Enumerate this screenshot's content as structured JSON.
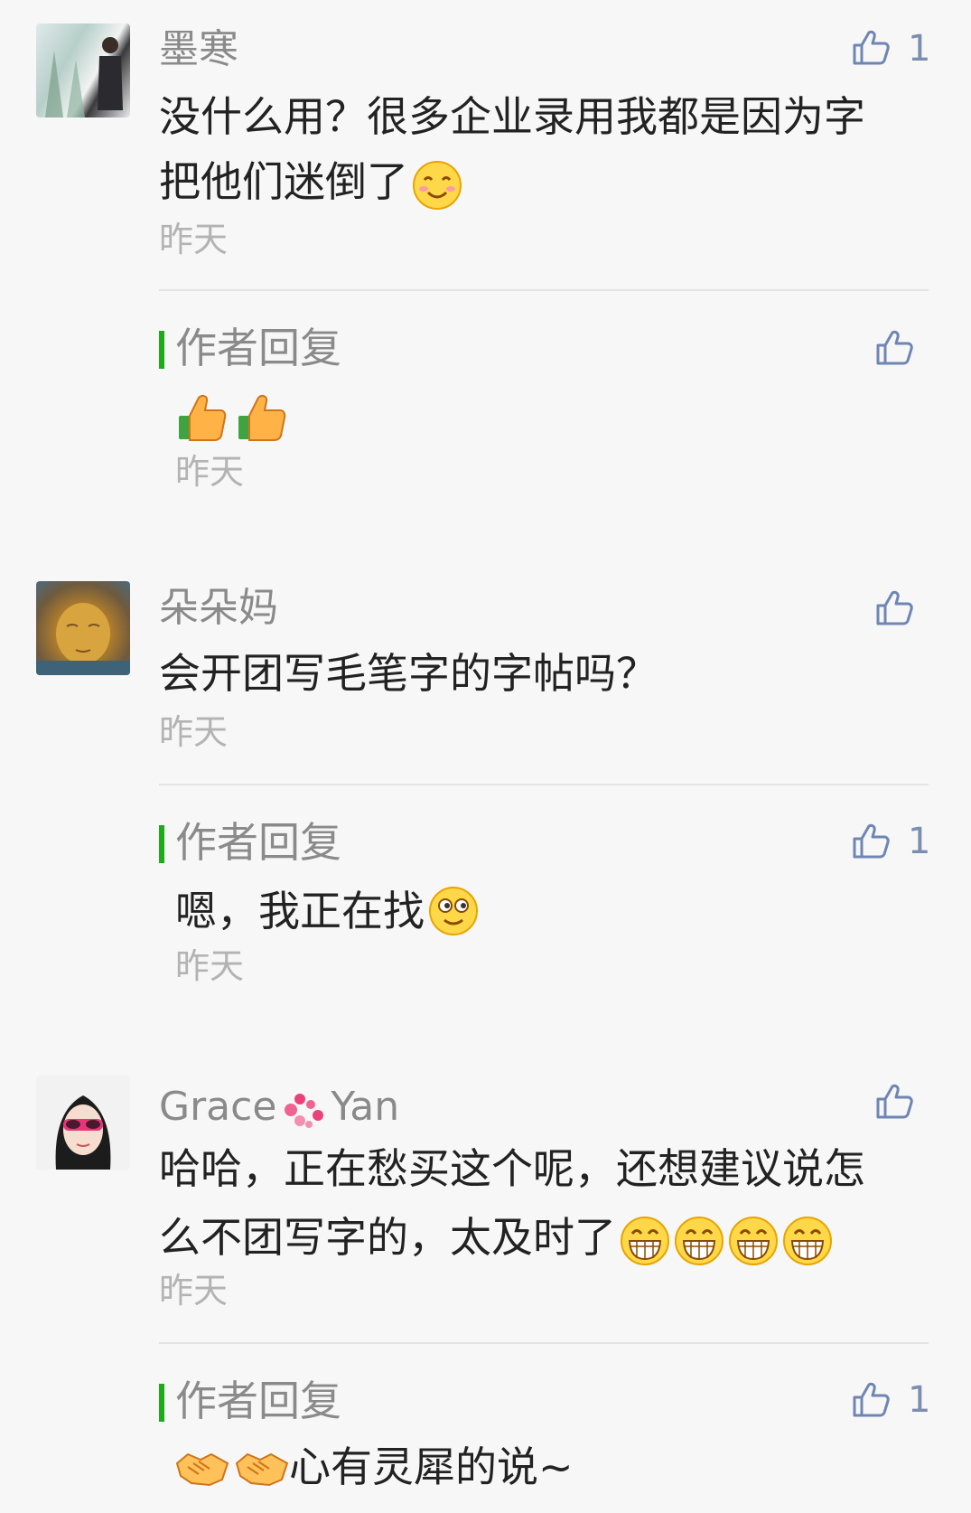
{
  "comments": [
    {
      "name": "墨寒",
      "line1": "没什么用？很多企业录用我都是因为字",
      "line2": "把他们迷倒了",
      "date": "昨天",
      "likes": "1",
      "reply": {
        "title": "作者回复",
        "text": "",
        "date": "昨天",
        "likes": ""
      }
    },
    {
      "name": "朵朵妈",
      "line1": "会开团写毛笔字的字帖吗？",
      "date": "昨天",
      "likes": "",
      "reply": {
        "title": "作者回复",
        "text": "嗯，我正在找",
        "date": "昨天",
        "likes": "1"
      }
    },
    {
      "name_a": "Grace",
      "name_b": "Yan",
      "line1": "哈哈，正在愁买这个呢，还想建议说怎",
      "line2": "么不团写字的，太及时了",
      "date": "昨天",
      "likes": "",
      "reply": {
        "title": "作者回复",
        "text": "心有灵犀的说~",
        "likes": "1"
      }
    }
  ],
  "icons": [
    "thumbs-up-icon",
    "smile-emoji",
    "thumbs-up-emoji",
    "grin-emoji",
    "handshake-emoji",
    "flower-icon"
  ],
  "colors": {
    "accent": "#1aad19",
    "like": "#7b8db0",
    "name": "#8a8a8a",
    "date": "#b3b3b3"
  }
}
